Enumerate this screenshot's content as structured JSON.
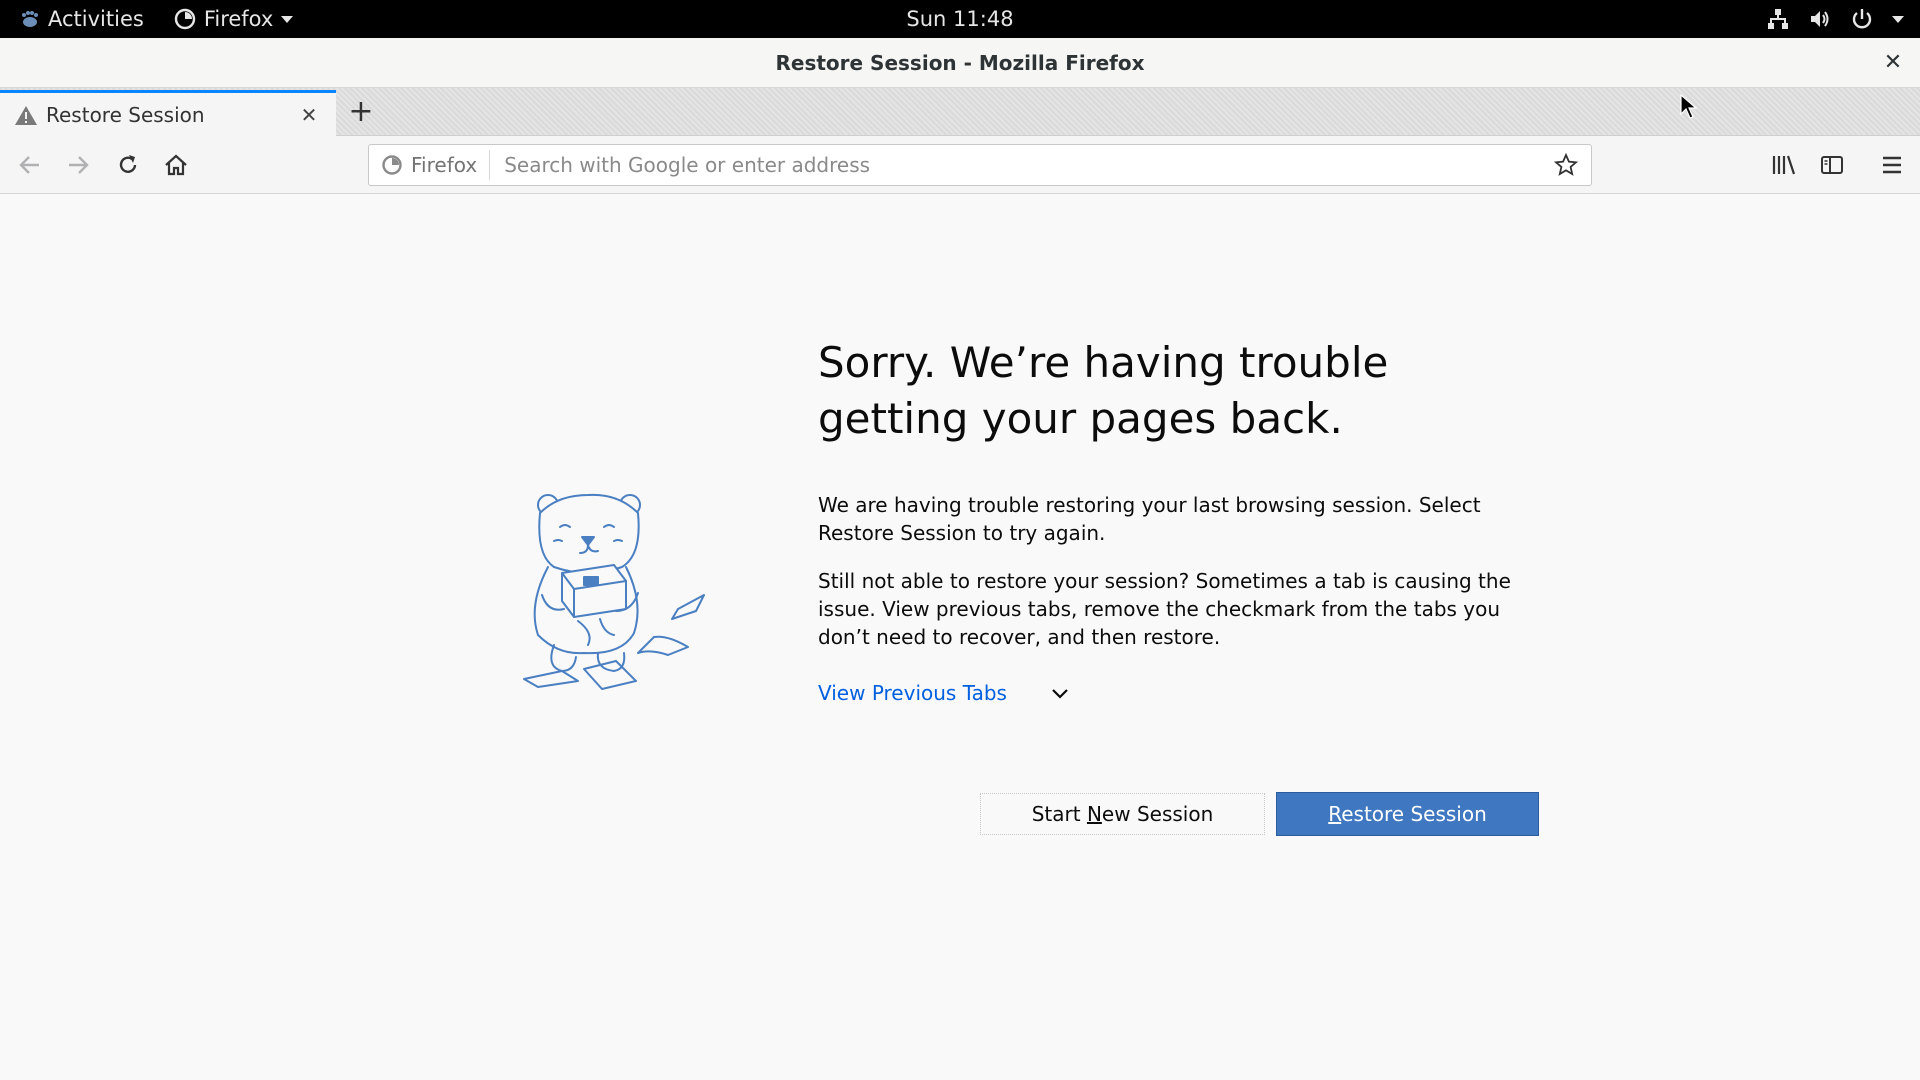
{
  "topbar": {
    "activities": "Activities",
    "app_menu": "Firefox",
    "clock": "Sun 11:48",
    "icons": [
      "network-icon",
      "volume-icon",
      "power-icon",
      "chevron-down-icon"
    ]
  },
  "window": {
    "title": "Restore Session - Mozilla Firefox"
  },
  "tabs": [
    {
      "label": "Restore Session",
      "icon": "warning-icon",
      "active": true
    }
  ],
  "navbar": {
    "identity_label": "Firefox",
    "url_value": "",
    "url_placeholder": "Search with Google or enter address"
  },
  "page": {
    "heading_line1": "Sorry. We’re having trouble",
    "heading_line2": "getting your pages back.",
    "paragraph1": "We are having trouble restoring your last browsing session. Select Restore Session to try again.",
    "paragraph2": "Still not able to restore your session? Sometimes a tab is causing the issue. View previous tabs, remove the checkmark from the tabs you don’t need to recover, and then restore.",
    "view_previous_tabs": "View Previous Tabs",
    "start_new_session": {
      "before": "Start ",
      "accesskey": "N",
      "after": "ew Session"
    },
    "restore_session": {
      "accesskey": "R",
      "after": "estore Session"
    }
  },
  "colors": {
    "accent_blue": "#0a84ff",
    "link_blue": "#0060df",
    "primary_button": "#3f77c1",
    "illustration_stroke": "#4a7fc1"
  }
}
